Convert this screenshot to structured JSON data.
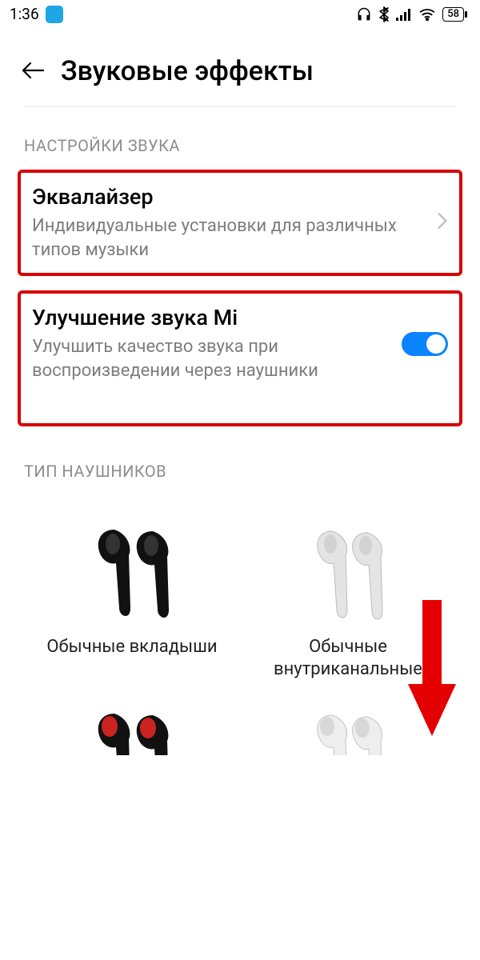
{
  "status": {
    "time": "1:36",
    "battery": "58"
  },
  "header": {
    "title": "Звуковые эффекты"
  },
  "sections": {
    "sound_settings_label": "НАСТРОЙКИ ЗВУКА",
    "headphone_type_label": "ТИП НАУШНИКОВ"
  },
  "equalizer": {
    "title": "Эквалайзер",
    "sub": "Индивидуальные установки для различных типов музыки"
  },
  "mi_enhance": {
    "title": "Улучшение звука Mi",
    "sub": "Улучшить качество звука при воспроизведении через наушники",
    "enabled": true
  },
  "headphones": [
    {
      "label": "Обычные вкладыши"
    },
    {
      "label": "Обычные внутриканальные"
    }
  ]
}
